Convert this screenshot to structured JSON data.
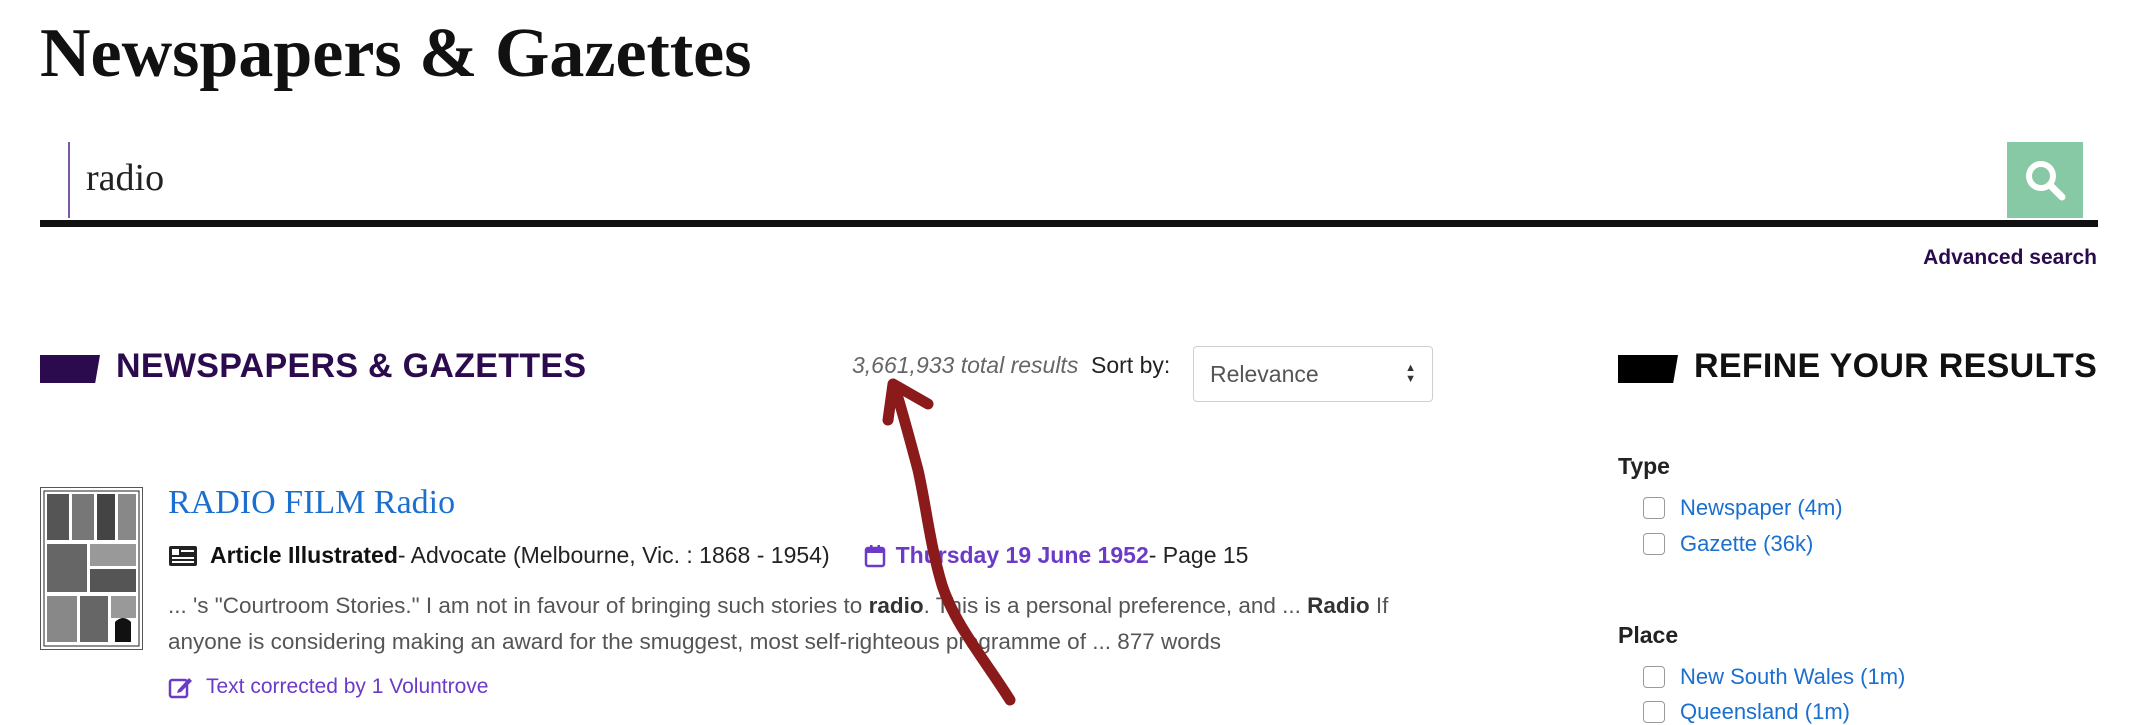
{
  "page": {
    "title": "Newspapers & Gazettes"
  },
  "search": {
    "value": "radio",
    "button_icon": "search-icon",
    "advanced_label": "Advanced search"
  },
  "results_section": {
    "heading": "NEWSPAPERS & GAZETTES",
    "total": "3,661,933 total results",
    "sort_label": "Sort by:",
    "sort_value": "Relevance"
  },
  "refine": {
    "heading": "REFINE YOUR RESULTS",
    "facets": [
      {
        "title": "Type",
        "options": [
          {
            "label": "Newspaper (4m)"
          },
          {
            "label": "Gazette (36k)"
          }
        ]
      },
      {
        "title": "Place",
        "options": [
          {
            "label": "New South Wales (1m)"
          },
          {
            "label": "Queensland (1m)"
          }
        ]
      }
    ]
  },
  "results": [
    {
      "title": "RADIO FILM Radio",
      "type_icon": "article-icon",
      "type": "Article Illustrated",
      "publication": " - Advocate (Melbourne, Vic. : 1868 - 1954)",
      "date_icon": "calendar-icon",
      "date": "Thursday 19 June 1952",
      "page": " - Page 15",
      "snippet": {
        "p1": "... 's \"Courtroom Stories.\" I am not in favour of bringing such stories to ",
        "b1": "radio",
        "p2": ". This is a personal preference, and ... ",
        "b2": "Radio",
        "p3": " If anyone is considering making an award for the smuggest, most self-righteous programme of ... 877 words"
      },
      "correction_icon": "edit-icon",
      "correction": "Text corrected by 1 Voluntrove"
    }
  ],
  "colors": {
    "brand_purple": "#2b0b4d",
    "search_button": "#86c9a4",
    "link_blue": "#1a6fcf",
    "date_purple": "#6b3bc7",
    "annotation_red": "#8b1a1a"
  }
}
